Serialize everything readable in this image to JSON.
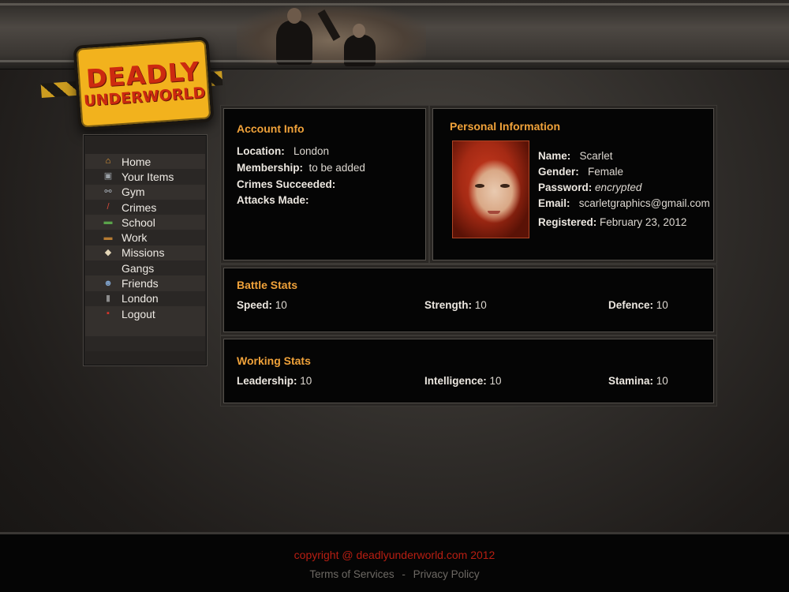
{
  "logo": {
    "line1": "DEADLY",
    "line2": "UNDERWORLD"
  },
  "nav": {
    "items": [
      {
        "label": "Home",
        "icon": "home-icon",
        "glyph": "⌂",
        "color": "#f3a53b"
      },
      {
        "label": "Your Items",
        "icon": "safe-icon",
        "glyph": "▣",
        "color": "#9aa0a6"
      },
      {
        "label": "Gym",
        "icon": "dumbbell-icon",
        "glyph": "⚯",
        "color": "#a9b0b8"
      },
      {
        "label": "Crimes",
        "icon": "knife-icon",
        "glyph": "/",
        "color": "#d84a3a"
      },
      {
        "label": "School",
        "icon": "chalkboard-icon",
        "glyph": "▬",
        "color": "#5aa34a"
      },
      {
        "label": "Work",
        "icon": "briefcase-icon",
        "glyph": "▬",
        "color": "#b67b32"
      },
      {
        "label": "Missions",
        "icon": "map-icon",
        "glyph": "◆",
        "color": "#e5d7b8"
      },
      {
        "label": "Gangs",
        "icon": "",
        "glyph": "",
        "color": "#000000"
      },
      {
        "label": "Friends",
        "icon": "friends-icon",
        "glyph": "☻",
        "color": "#7ea0c8"
      },
      {
        "label": "London",
        "icon": "phone-icon",
        "glyph": "▮",
        "color": "#8c8c8c"
      },
      {
        "label": "Logout",
        "icon": "logout-icon",
        "glyph": "▪",
        "color": "#d8342a"
      }
    ]
  },
  "account": {
    "title": "Account Info",
    "location_label": "Location:",
    "location": "London",
    "membership_label": "Membership:",
    "membership": "to be added",
    "crimes_label": "Crimes Succeeded:",
    "attacks_label": "Attacks Made:"
  },
  "personal": {
    "title": "Personal Information",
    "name_label": "Name:",
    "name": "Scarlet",
    "gender_label": "Gender:",
    "gender": "Female",
    "password_label": "Password:",
    "password": "encrypted",
    "email_label": "Email:",
    "email": "scarletgraphics@gmail.com",
    "registered_label": "Registered:",
    "registered": "February 23, 2012"
  },
  "battle": {
    "title": "Battle Stats",
    "speed_label": "Speed:",
    "speed": "10",
    "strength_label": "Strength:",
    "strength": "10",
    "defence_label": "Defence:",
    "defence": "10"
  },
  "working": {
    "title": "Working Stats",
    "leadership_label": "Leadership:",
    "leadership": "10",
    "intelligence_label": "Intelligence:",
    "intelligence": "10",
    "stamina_label": "Stamina:",
    "stamina": "10"
  },
  "footer": {
    "copyright": "copyright @ deadlyunderworld.com 2012",
    "terms": "Terms of Services",
    "separator": "-",
    "privacy": "Privacy Policy"
  },
  "colors": {
    "accent": "#f0a23a",
    "logo_bg": "#f2b21d",
    "logo_text": "#cc2a10",
    "footer_red": "#b81e12"
  }
}
